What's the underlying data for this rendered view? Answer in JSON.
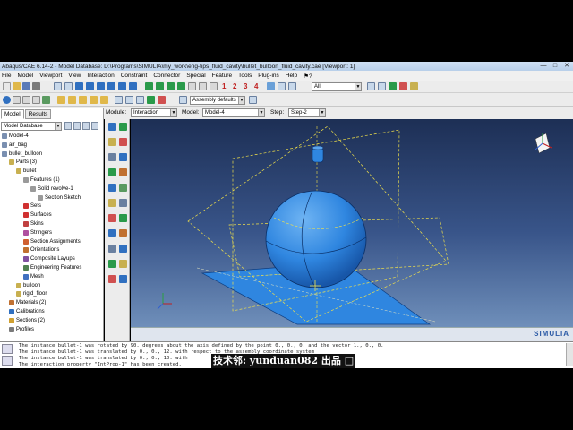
{
  "window": {
    "title": "Abaqus/CAE 6.14-2 - Model Database: D:\\Programs\\SIMULIA\\my_work\\eng-tips_fluid_cavity\\bullet_bulloon_fluid_cavity.cae [Viewport: 1]",
    "controls": [
      "—",
      "□",
      "✕"
    ]
  },
  "menu": [
    "File",
    "Model",
    "Viewport",
    "View",
    "Interaction",
    "Constraint",
    "Connector",
    "Special",
    "Feature",
    "Tools",
    "Plug-ins",
    "Help",
    "⚑?"
  ],
  "toolbar": {
    "selection_filter": "All",
    "render_mode": "Assembly defaults",
    "numbers": [
      "1",
      "2",
      "3",
      "4"
    ]
  },
  "context": {
    "module_label": "Module:",
    "module_value": "Interaction",
    "model_label": "Model:",
    "model_value": "Model-4",
    "step_label": "Step:",
    "step_value": "Step-2"
  },
  "tree": {
    "tabs": [
      "Model",
      "Results"
    ],
    "selector": "Model Database",
    "nodes": [
      {
        "label": "Model-4",
        "indent": 0,
        "color": "#7a8fb0"
      },
      {
        "label": "air_bag",
        "indent": 0,
        "color": "#7a8fb0"
      },
      {
        "label": "bullet_bulloon",
        "indent": 0,
        "color": "#7a8fb0"
      },
      {
        "label": "Parts (3)",
        "indent": 1,
        "color": "#c8b050"
      },
      {
        "label": "bullet",
        "indent": 2,
        "color": "#c8b050"
      },
      {
        "label": "Features (1)",
        "indent": 3,
        "color": "#9a9a9a"
      },
      {
        "label": "Solid revolve-1",
        "indent": 4,
        "color": "#9a9a9a"
      },
      {
        "label": "Section Sketch",
        "indent": 5,
        "color": "#9a9a9a"
      },
      {
        "label": "Sets",
        "indent": 3,
        "color": "#d03030"
      },
      {
        "label": "Surfaces",
        "indent": 3,
        "color": "#d03030"
      },
      {
        "label": "Skins",
        "indent": 3,
        "color": "#c04040"
      },
      {
        "label": "Stringers",
        "indent": 3,
        "color": "#b050a0"
      },
      {
        "label": "Section Assignments",
        "indent": 3,
        "color": "#d06030"
      },
      {
        "label": "Orientations",
        "indent": 3,
        "color": "#c07030"
      },
      {
        "label": "Composite Layups",
        "indent": 3,
        "color": "#8050a0"
      },
      {
        "label": "Engineering Features",
        "indent": 3,
        "color": "#508050"
      },
      {
        "label": "Mesh",
        "indent": 3,
        "color": "#4070c0"
      },
      {
        "label": "bulloon",
        "indent": 2,
        "color": "#c8b050"
      },
      {
        "label": "rigid_floor",
        "indent": 2,
        "color": "#c8b050"
      },
      {
        "label": "Materials (2)",
        "indent": 1,
        "color": "#c07030"
      },
      {
        "label": "Calibrations",
        "indent": 1,
        "color": "#3070c0"
      },
      {
        "label": "Sections (2)",
        "indent": 1,
        "color": "#d0a030"
      },
      {
        "label": "Profiles",
        "indent": 1,
        "color": "#7a7a7a"
      }
    ]
  },
  "viewport": {
    "brand": "SIMULIA"
  },
  "messages": [
    "The instance bullet-1 was rotated by 90. degrees about the axis defined by the point 0., 0., 0. and the vector 1., 0., 0.",
    "The instance bullet-1 was translated by 0., 0., 12. with respect to the assembly coordinate system",
    "The instance bullet-1 was translated by 0., 0., 10. with",
    "The interaction property \"IntProp-1\" has been created."
  ],
  "watermark": "技术邻: yunduan082 出品 □",
  "colors": {
    "viewport_top": "#1d2f55",
    "viewport_bottom": "#6f8fba",
    "part_blue": "#2f86e0",
    "datum_yellow": "#f2e24a"
  }
}
